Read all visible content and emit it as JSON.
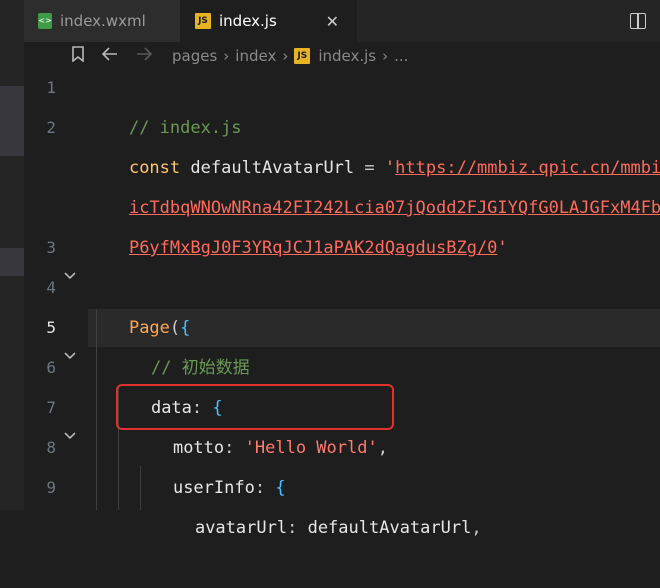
{
  "tabs": [
    {
      "label": "index.wxml",
      "icon": "wxml-file-icon"
    },
    {
      "label": "index.js",
      "icon": "js-file-icon",
      "active": true
    }
  ],
  "breadcrumb": [
    "pages",
    "index",
    "index.js",
    "..."
  ],
  "icons": {
    "bookmark": "bookmark-icon",
    "back": "back-arrow-icon",
    "forward": "forward-arrow-icon",
    "split": "split-editor-icon",
    "close": "close-icon"
  },
  "colors": {
    "annotation": "#e03030",
    "editor_bg": "#1e1e1e"
  },
  "code": {
    "line_numbers": [
      "1",
      "2",
      "",
      "",
      "3",
      "4",
      "5",
      "6",
      "7",
      "8",
      "9"
    ],
    "l1_comment": "// index.js",
    "l2_const": "const",
    "l2_name": "defaultAvatarUrl",
    "l2_eq": "=",
    "l2_quote": "'",
    "l2_url1": "https://mmbiz.qpic.cn/mmbi",
    "l2_url2": "icTdbqWNOwNRna42FI242Lcia07jQodd2FJGIYQfG0LAJGFxM4Fb",
    "l2_url3": "P6yfMxBgJ0F3YRqJCJ1aPAK2dQagdusBZg/0",
    "l2_close": "'",
    "l4_page": "Page",
    "l4_paren": "(",
    "l4_brace": "{",
    "l5_comment": "// 初始数据",
    "l6_key": "data",
    "l6_colon": ":",
    "l6_brace": "{",
    "l7_key": "motto",
    "l7_colon": ":",
    "l7_val": "'Hello World'",
    "l7_comma": ",",
    "l8_key": "userInfo",
    "l8_colon": ":",
    "l8_brace": "{",
    "l9_key": "avatarUrl",
    "l9_colon": ":",
    "l9_val": "defaultAvatarUrl",
    "l9_comma": ","
  }
}
